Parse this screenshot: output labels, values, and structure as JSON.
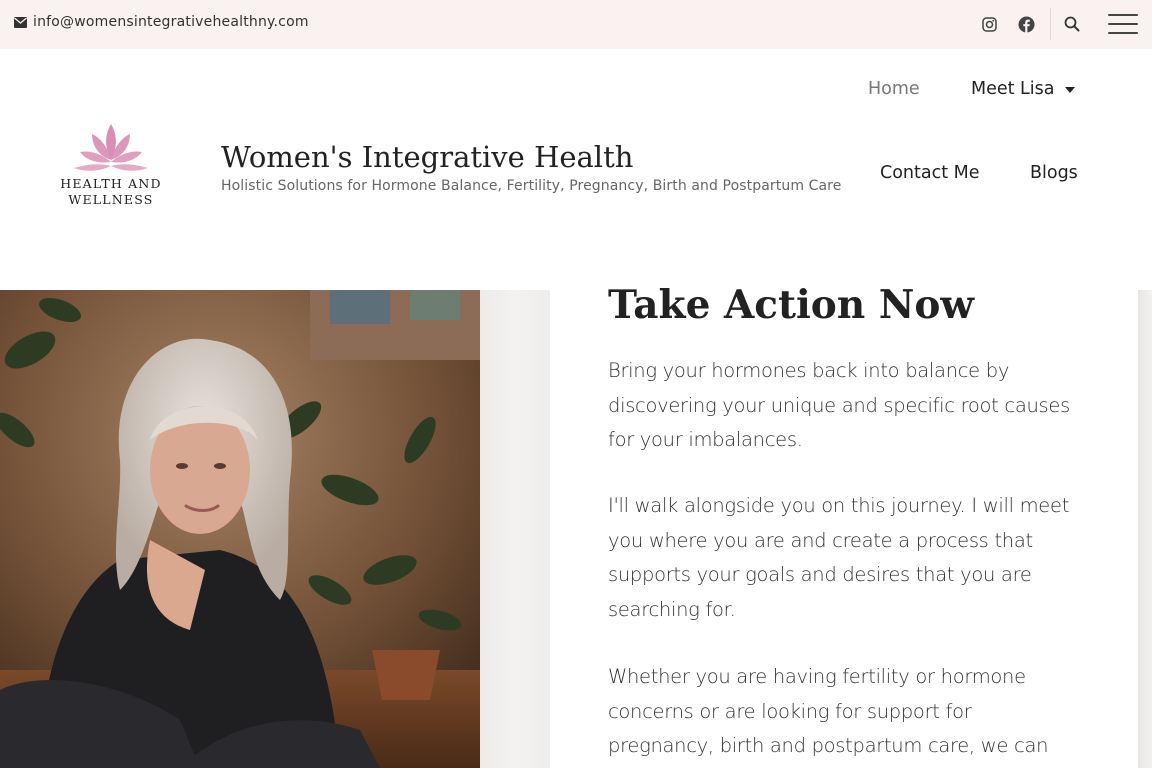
{
  "topbar": {
    "email": "info@womensintegrativehealthny.com",
    "icons": [
      "envelope-icon",
      "instagram-icon",
      "facebook-icon",
      "search-icon",
      "menu-icon"
    ]
  },
  "header": {
    "logo_text_line1": "HEALTH AND",
    "logo_text_line2": "WELLNESS",
    "site_title": "Women's Integrative Health",
    "tagline": "Holistic Solutions for Hormone Balance, Fertility, Pregnancy, Birth and Postpartum Care"
  },
  "nav": {
    "home": "Home",
    "meet_lisa": "Meet Lisa",
    "contact": "Contact Me",
    "blogs": "Blogs"
  },
  "hero": {
    "heading": "Take Action Now",
    "paragraphs": [
      "Bring your hormones back into balance by discovering your unique and specific root causes for your imbalances.",
      "I'll walk alongside you on this journey.  I will meet you where you are and create a process that supports your goals and desires that you are searching for.",
      "Whether you are having fertility or hormone concerns or are looking for support for pregnancy, birth and postpartum care, we can work together to"
    ]
  },
  "colors": {
    "topbar_bg": "#faf1f1",
    "lotus_pink": "#d98fb5",
    "text_dark": "#222222"
  }
}
